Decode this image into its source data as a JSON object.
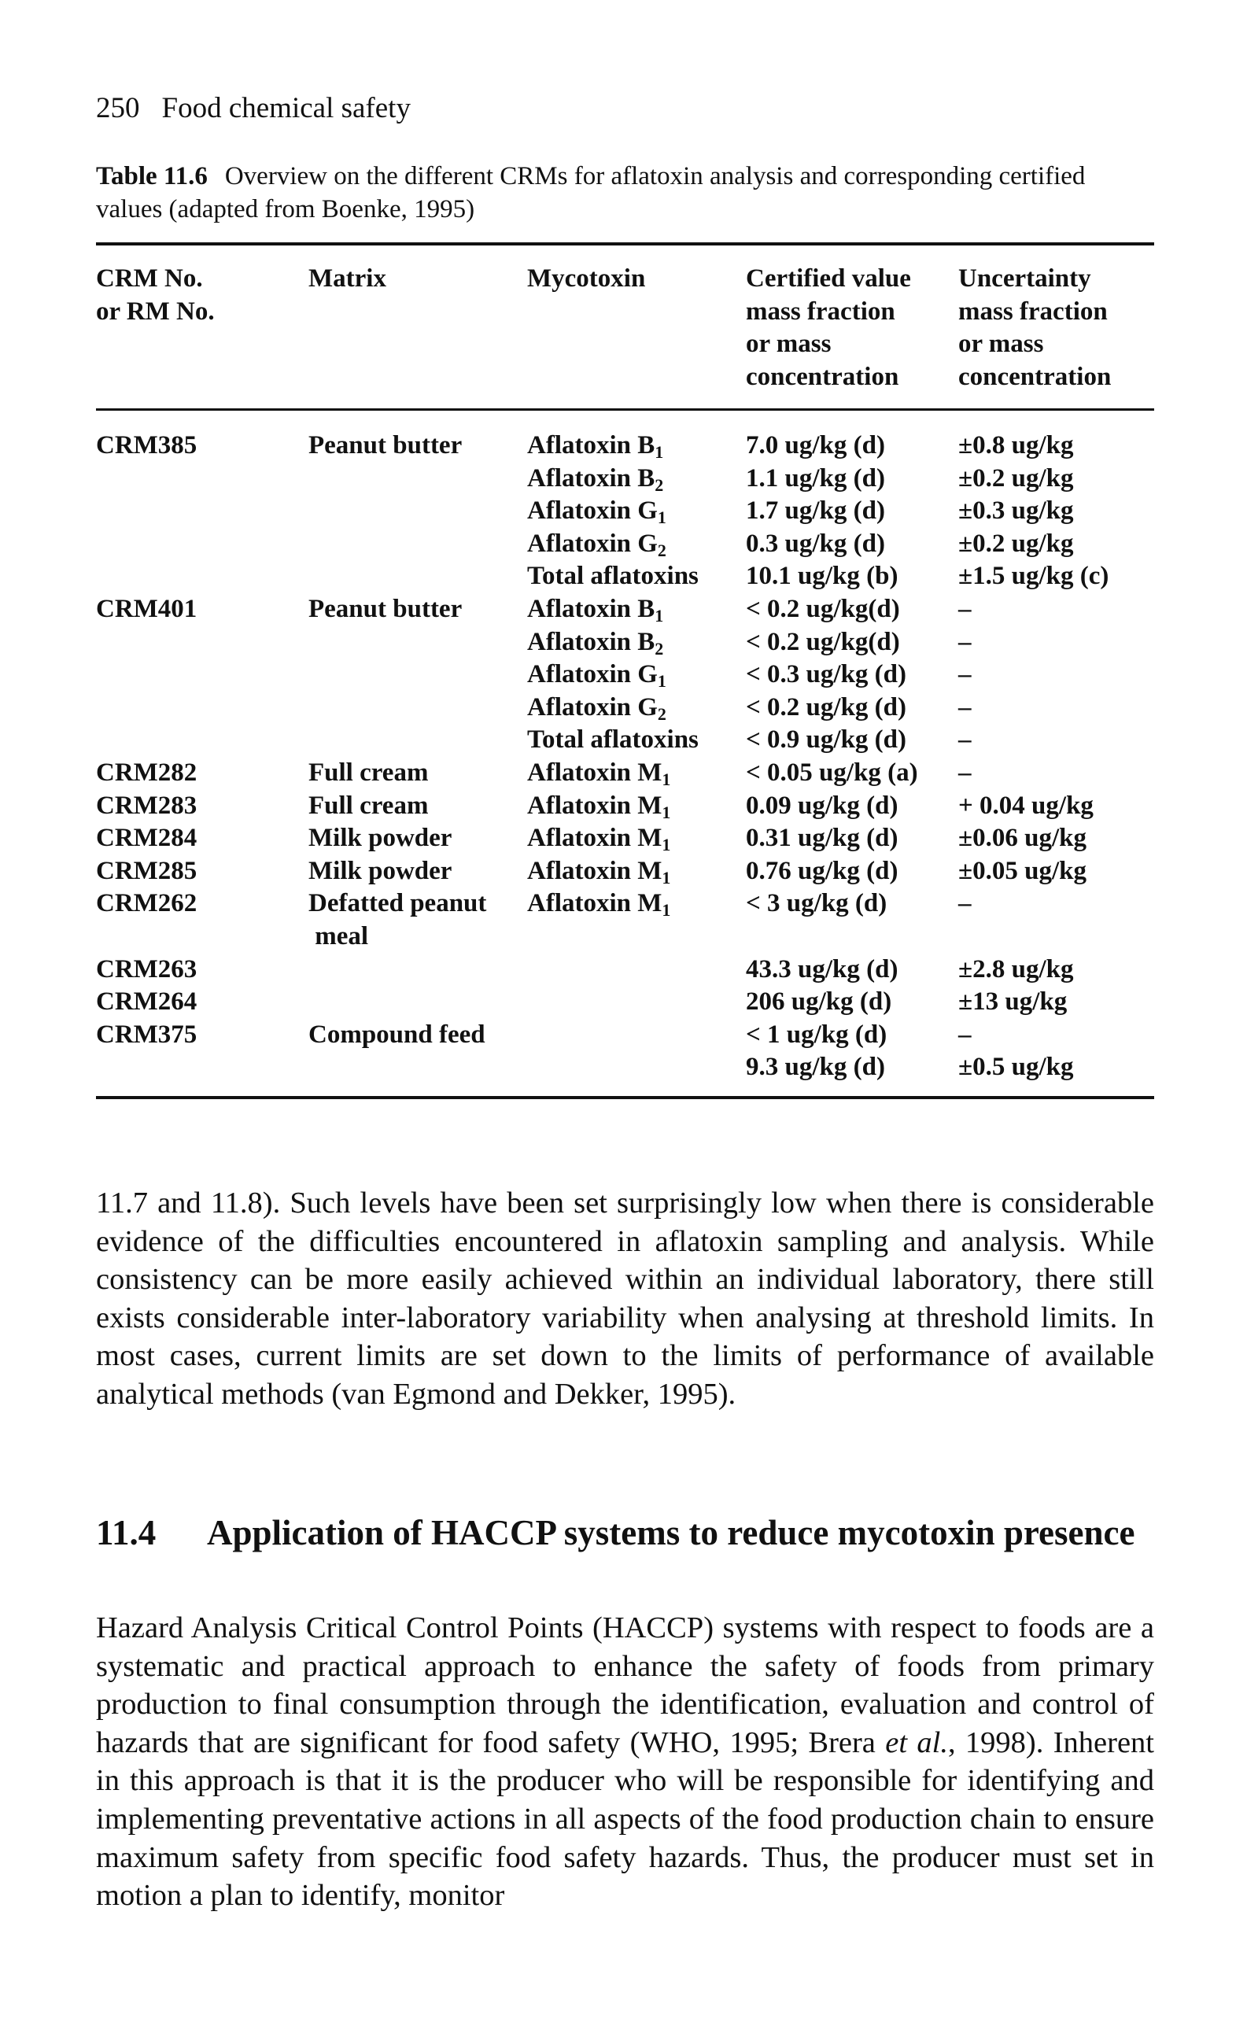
{
  "running_header": {
    "page_number": "250",
    "book_title": "Food chemical safety"
  },
  "table": {
    "label": "Table 11.6",
    "caption": "Overview on the different CRMs for aflatoxin analysis and corresponding certified values (adapted from Boenke, 1995)",
    "columns": [
      [
        "CRM No.",
        "or RM No."
      ],
      [
        "Matrix"
      ],
      [
        "Mycotoxin"
      ],
      [
        "Certified value",
        "mass fraction",
        "or mass",
        "concentration"
      ],
      [
        "Uncertainty",
        "mass fraction",
        "or mass",
        "concentration"
      ]
    ],
    "rows": [
      {
        "crm": "CRM385",
        "matrix": "Peanut butter",
        "toxin": "Aflatoxin B",
        "sub": "1",
        "value": "7.0 ug/kg (d)",
        "uncertainty": "±0.8 ug/kg"
      },
      {
        "crm": "",
        "matrix": "",
        "toxin": "Aflatoxin B",
        "sub": "2",
        "value": "1.1 ug/kg (d)",
        "uncertainty": "±0.2 ug/kg"
      },
      {
        "crm": "",
        "matrix": "",
        "toxin": "Aflatoxin G",
        "sub": "1",
        "value": "1.7 ug/kg (d)",
        "uncertainty": "±0.3 ug/kg"
      },
      {
        "crm": "",
        "matrix": "",
        "toxin": "Aflatoxin G",
        "sub": "2",
        "value": "0.3 ug/kg (d)",
        "uncertainty": "±0.2 ug/kg"
      },
      {
        "crm": "",
        "matrix": "",
        "toxin": "Total aflatoxins",
        "sub": "",
        "value": "10.1 ug/kg (b)",
        "uncertainty": "±1.5 ug/kg (c)"
      },
      {
        "crm": "CRM401",
        "matrix": "Peanut butter",
        "toxin": "Aflatoxin B",
        "sub": "1",
        "value": "< 0.2 ug/kg(d)",
        "uncertainty": "–"
      },
      {
        "crm": "",
        "matrix": "",
        "toxin": "Aflatoxin B",
        "sub": "2",
        "value": "< 0.2 ug/kg(d)",
        "uncertainty": "–"
      },
      {
        "crm": "",
        "matrix": "",
        "toxin": "Aflatoxin G",
        "sub": "1",
        "value": "< 0.3 ug/kg (d)",
        "uncertainty": "–"
      },
      {
        "crm": "",
        "matrix": "",
        "toxin": "Aflatoxin G",
        "sub": "2",
        "value": "< 0.2 ug/kg (d)",
        "uncertainty": "–"
      },
      {
        "crm": "",
        "matrix": "",
        "toxin": "Total aflatoxins",
        "sub": "",
        "value": "< 0.9 ug/kg (d)",
        "uncertainty": "–"
      },
      {
        "crm": "CRM282",
        "matrix": "Full cream",
        "toxin": "Aflatoxin M",
        "sub": "1",
        "value": "< 0.05 ug/kg (a)",
        "uncertainty": "–"
      },
      {
        "crm": "CRM283",
        "matrix": "Full cream",
        "toxin": "Aflatoxin M",
        "sub": "1",
        "value": "0.09 ug/kg (d)",
        "uncertainty": "+ 0.04 ug/kg"
      },
      {
        "crm": "CRM284",
        "matrix": "Milk powder",
        "toxin": "Aflatoxin M",
        "sub": "1",
        "value": "0.31 ug/kg (d)",
        "uncertainty": "±0.06 ug/kg"
      },
      {
        "crm": "CRM285",
        "matrix": "Milk powder",
        "toxin": "Aflatoxin M",
        "sub": "1",
        "value": "0.76 ug/kg (d)",
        "uncertainty": "±0.05 ug/kg"
      },
      {
        "crm": "CRM262",
        "matrix": "Defatted peanut",
        "toxin": "Aflatoxin M",
        "sub": "1",
        "value": "< 3 ug/kg (d)",
        "uncertainty": "–"
      },
      {
        "crm": "",
        "matrix": " meal",
        "toxin": "",
        "sub": "",
        "value": "",
        "uncertainty": ""
      },
      {
        "crm": "CRM263",
        "matrix": "",
        "toxin": "",
        "sub": "",
        "value": "43.3 ug/kg (d)",
        "uncertainty": "±2.8 ug/kg"
      },
      {
        "crm": "CRM264",
        "matrix": "",
        "toxin": "",
        "sub": "",
        "value": "206 ug/kg (d)",
        "uncertainty": "±13 ug/kg"
      },
      {
        "crm": "CRM375",
        "matrix": "Compound feed",
        "toxin": "",
        "sub": "",
        "value": "< 1 ug/kg (d)",
        "uncertainty": "–"
      },
      {
        "crm": "",
        "matrix": "",
        "toxin": "",
        "sub": "",
        "value": "9.3 ug/kg (d)",
        "uncertainty": "±0.5 ug/kg"
      }
    ]
  },
  "paragraph1": "11.7 and 11.8). Such levels have been set surprisingly low when there is considerable evidence of the difficulties encountered in aflatoxin sampling and analysis. While consistency can be more easily achieved within an individual laboratory, there still exists considerable inter-laboratory variability when analysing at threshold limits. In most cases, current limits are set down to the limits of performance of available analytical methods (van Egmond and Dekker, 1995).",
  "section": {
    "number": "11.4",
    "title": "Application of HACCP systems to reduce mycotoxin presence"
  },
  "paragraph2": {
    "before_italic": "Hazard Analysis Critical Control Points (HACCP) systems with respect to foods are a systematic and practical approach to enhance the safety of foods from primary production to final consumption through the identification, evaluation and control of hazards that are significant for food safety (WHO, 1995; Brera ",
    "italic": "et al.",
    "after_italic": ", 1998). Inherent in this approach is that it is the producer who will be responsible for identifying and implementing preventative actions in all aspects of the food production chain to ensure maximum safety from specific food safety hazards. Thus, the producer must set in motion a plan to identify, monitor"
  }
}
